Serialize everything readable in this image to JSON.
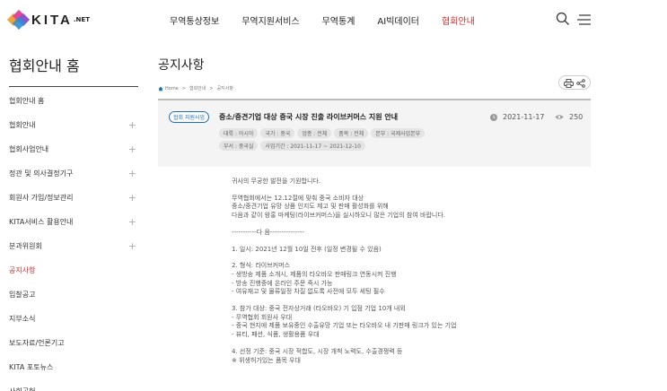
{
  "header": {
    "logo_text": "KITA",
    "logo_suffix": ".NET",
    "nav": [
      {
        "label": "무역통상정보"
      },
      {
        "label": "무역지원서비스"
      },
      {
        "label": "무역통계"
      },
      {
        "label": "AI빅데이터"
      },
      {
        "label": "협회안내",
        "active": true
      }
    ],
    "icons": [
      "search-icon",
      "menu-icon"
    ]
  },
  "sidebar": {
    "title": "협회안내 홈",
    "items": [
      {
        "label": "협회안내 홈",
        "expandable": false
      },
      {
        "label": "협회안내",
        "expandable": true
      },
      {
        "label": "협회사업안내",
        "expandable": true
      },
      {
        "label": "정관 및 의사결정기구",
        "expandable": true
      },
      {
        "label": "회원사 가입/정보관리",
        "expandable": true
      },
      {
        "label": "KITA서비스 활용안내",
        "expandable": true
      },
      {
        "label": "분과위원회",
        "expandable": true
      },
      {
        "label": "공지사항",
        "expandable": false,
        "active": true
      },
      {
        "label": "입찰공고",
        "expandable": false
      },
      {
        "label": "지부소식",
        "expandable": false
      },
      {
        "label": "보도자료/언론기고",
        "expandable": false
      },
      {
        "label": "KITA 포토뉴스",
        "expandable": false
      },
      {
        "label": "사회공헌",
        "expandable": false
      }
    ]
  },
  "main": {
    "page_title": "공지사항",
    "breadcrumb": [
      "Home",
      "협회안내",
      "공지사항"
    ],
    "tools": [
      "print-icon",
      "share-icon"
    ]
  },
  "post": {
    "badge": "협회 지원사업",
    "title": "중소/중견기업 대상 중국 시장 진출 라이브커머스 지원 안내",
    "date": "2021-11-17",
    "views": "250",
    "tags_row1": [
      "대륙 : 아시아",
      "국가 : 중국",
      "업종 : 전체",
      "품목 : 전체",
      "본부 : 국제사업본부"
    ],
    "tags_row2": [
      "부서 : 중국실",
      "사업기간 : 2021-11-17 ~ 2021-12-10"
    ]
  },
  "content": {
    "paragraphs": [
      [
        "귀사의 무궁한 발전을 기원합니다."
      ],
      [
        "무역협회에서는 12.12절에 맞춰 중국 소비자 대상",
        "중소/중견기업 유망 상품 인지도 제고 및 판매 활성화를 위해",
        "다음과 같이 왕홍 마케팅(라이브커머스)을 실시하오니 많은 기업의 참여 바랍니다."
      ],
      [
        "-----------다 음---------------"
      ],
      [
        "1. 일시: 2021년 12월 10일 전후 (일정 변경될 수 있음)"
      ],
      [
        "2. 형식: 라이브커머스",
        "- 생방송 제품 소개시, 제품의 타오바오 판매링크 연동시켜 진행",
        "- 방송 진행중에 온라인 주문 즉시 가능",
        "- 여유재고 및 물류일정 차질 없도록 사전에 모두 세팅 필수"
      ],
      [
        "3. 참가 대상: 중국 전자상거래 (타오바오) 기 입점 기업 10개 내외",
        "- 무역협회 회원사 우대",
        "- 중국 현지에 제품 보유중인 수출유망 기업 또는 타오바오 내 기판매 링크가 있는 기업",
        "- 뷰티, 패션, 식품, 생활용품 우대"
      ],
      [
        "4. 선정 기준: 중국 시장 적합도, 시장 개척 노력도, 수출경쟁력 등",
        "※ 위생허가있는 품목 우대"
      ]
    ]
  }
}
